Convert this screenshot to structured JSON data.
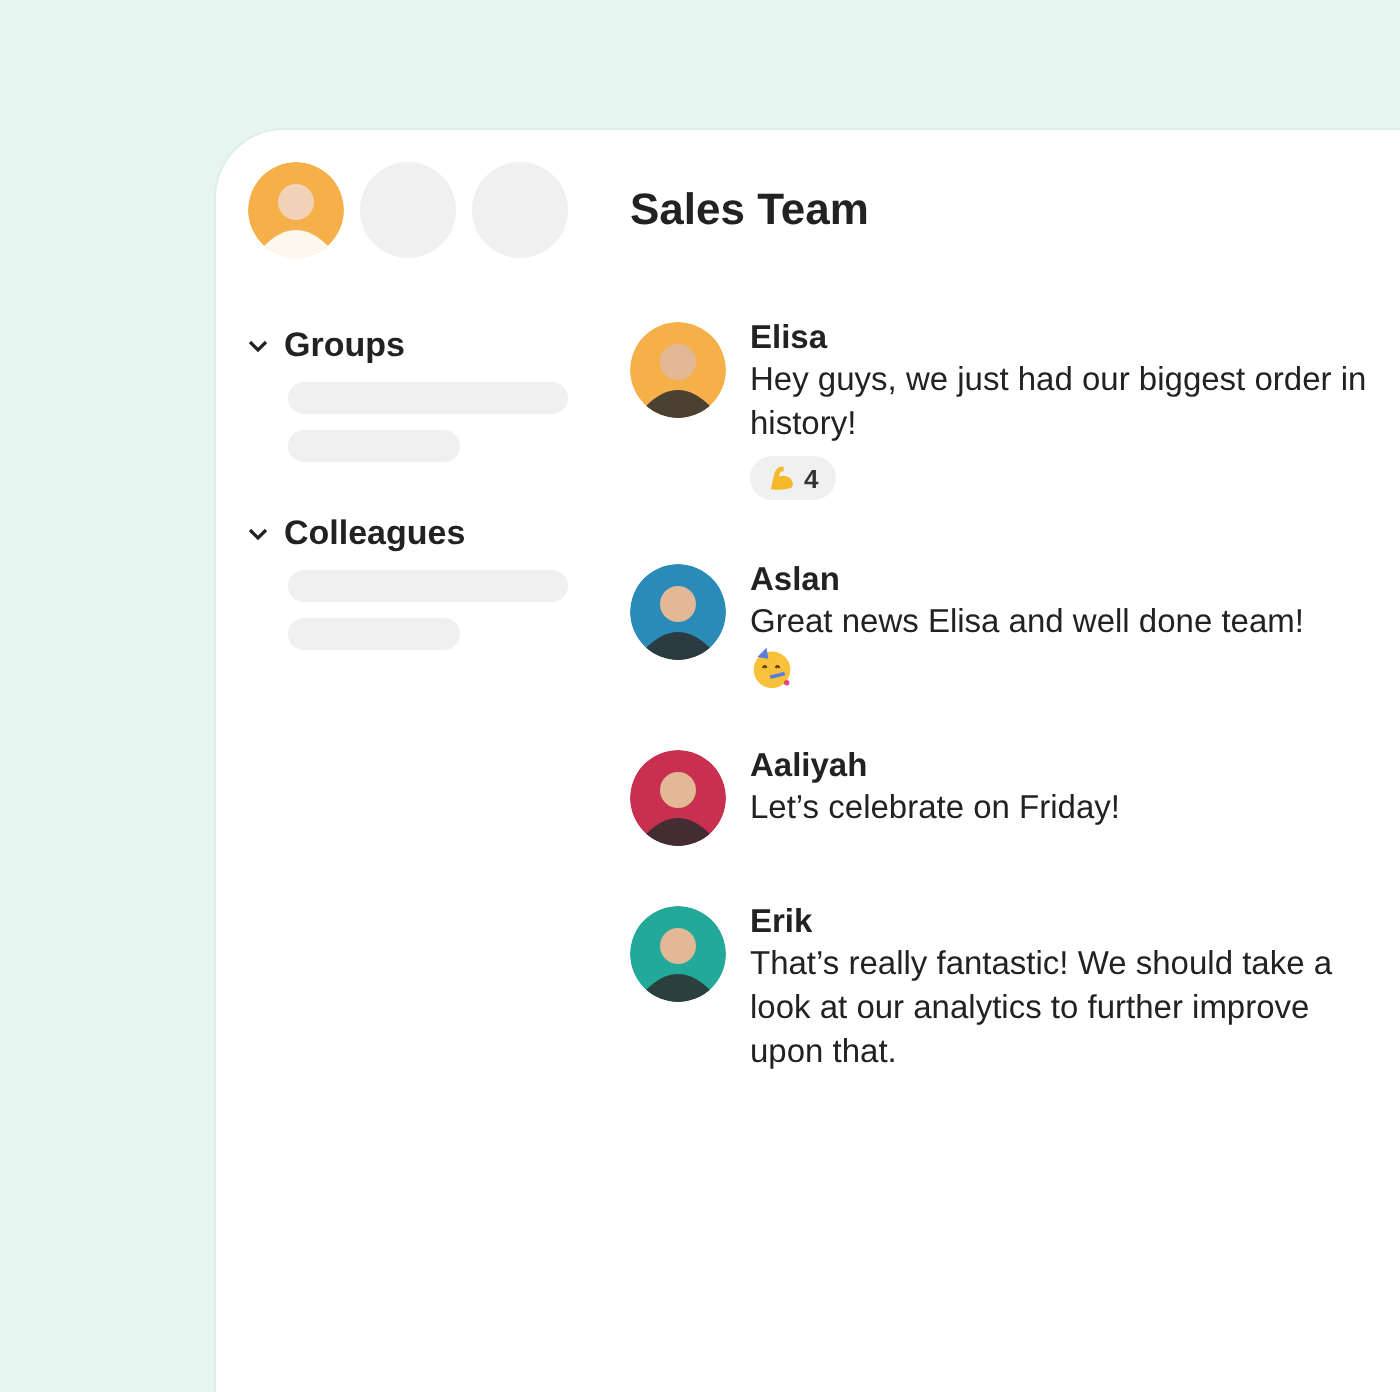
{
  "sidebar": {
    "profiles": [
      {
        "kind": "avatar",
        "color": "#f6b04a"
      },
      {
        "kind": "empty"
      },
      {
        "kind": "empty"
      }
    ],
    "sections": [
      {
        "label": "Groups",
        "expanded": true
      },
      {
        "label": "Colleagues",
        "expanded": true
      }
    ]
  },
  "chat": {
    "title": "Sales Team",
    "messages": [
      {
        "name": "Elisa",
        "text": "Hey guys, we just had our biggest order in history!",
        "color": "#f6b04a",
        "reaction": {
          "count": "4"
        }
      },
      {
        "name": "Aslan",
        "text": "Great news Elisa and well done team!",
        "color": "#2a8bb8",
        "emoji": true
      },
      {
        "name": "Aaliyah",
        "text": "Let’s celebrate on Friday!",
        "color": "#c9304f"
      },
      {
        "name": "Erik",
        "text": "That’s really fantastic! We should take a look at our analytics to further improve upon that.",
        "color": "#22a999"
      }
    ]
  }
}
